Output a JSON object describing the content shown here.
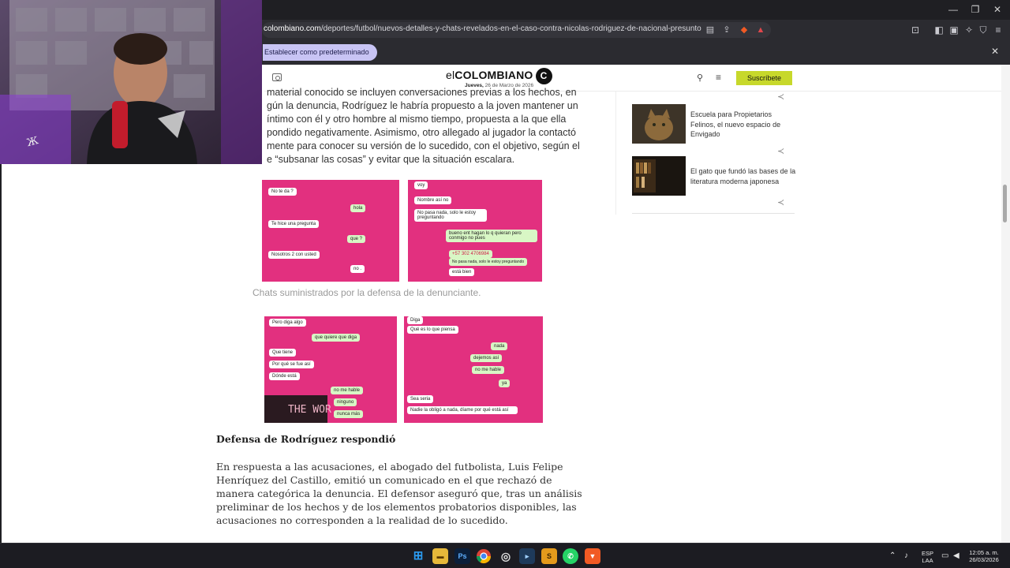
{
  "browser": {
    "url_domain": "colombiano.com",
    "url_path": "/deportes/futbol/nuevos-detalles-y-chats-revelados-en-el-caso-contra-nicolas-rodriguez-de-nacional-presunto-abuso-sexua...",
    "default_button": "Establecer como predeterminado",
    "accent_color": "#c8c4f4"
  },
  "site": {
    "logo_prefix": "el",
    "logo_main": "COLOMBIANO",
    "logo_mark": "C",
    "date_day": "Jueves,",
    "date_rest": "26 de Marzo de 2026",
    "subscribe_label": "Suscríbete",
    "subscribe_color": "#c7d82b"
  },
  "article": {
    "top_lines": [
      "material conocido se incluyen conversaciones previas a los hechos, en",
      "gún la denuncia, Rodríguez le habría propuesto a la joven mantener un",
      "íntimo con él y otro hombre al mismo tiempo, propuesta a la que ella",
      "pondido negativamente. Asimismo, otro allegado al jugador la contactó",
      "mente para conocer su versión de lo sucedido, con el objetivo, según el",
      "e “subsanar las cosas” y evitar que la situación escalara."
    ],
    "chat_set_1": {
      "left": [
        "No te da ?",
        "hola",
        "Te hice una pregunta",
        "que ?",
        "Nosotros 2 con usted",
        "no ."
      ],
      "right": [
        "voy",
        "Nombre así no",
        "No pasa nada, solo le estoy preguntando",
        "bueno ent hagan lo q quieran pero conmigo no pues",
        "+57 302 4706984",
        "No pasa nada, solo le estoy preguntando",
        "está bien"
      ]
    },
    "caption": "Chats suministrados por la defensa de la denunciante.",
    "chat_set_2": {
      "left": [
        "Pero diga algo",
        "que quiere que diga",
        "Que tiene",
        "Por qué se fue así",
        "Dónde está",
        "no me hable",
        "ninguno",
        "nunca más",
        "THE WOR"
      ],
      "right": [
        "Diga",
        "Qué es lo que piensa",
        "nada",
        "dejemos así",
        "no me hable",
        "ya",
        "Sea seria",
        "Nadie la obligó a nada, díame por qué está así"
      ]
    },
    "subheading": "Defensa de Rodríguez respondió",
    "body": "En respuesta a las acusaciones, el abogado del futbolista, Luis Felipe Henríquez del Castillo, emitió un comunicado en el que rechazó de manera categórica la denuncia. El defensor aseguró que, tras un análisis preliminar de los hechos y de los elementos probatorios disponibles, las acusaciones no corresponden a la realidad de lo sucedido."
  },
  "sidebar": {
    "items": [
      {
        "title": "Escuela para Propietarios Felinos, el nuevo espacio de Envigado",
        "icon": "cat-photo"
      },
      {
        "title": "El gato que fundó las bases de la literatura moderna japonesa",
        "icon": "bookshelf-photo"
      }
    ]
  },
  "taskbar": {
    "lang_top": "ESP",
    "lang_bottom": "LAA",
    "time": "12:05 a. m.",
    "date": "26/03/2026"
  }
}
